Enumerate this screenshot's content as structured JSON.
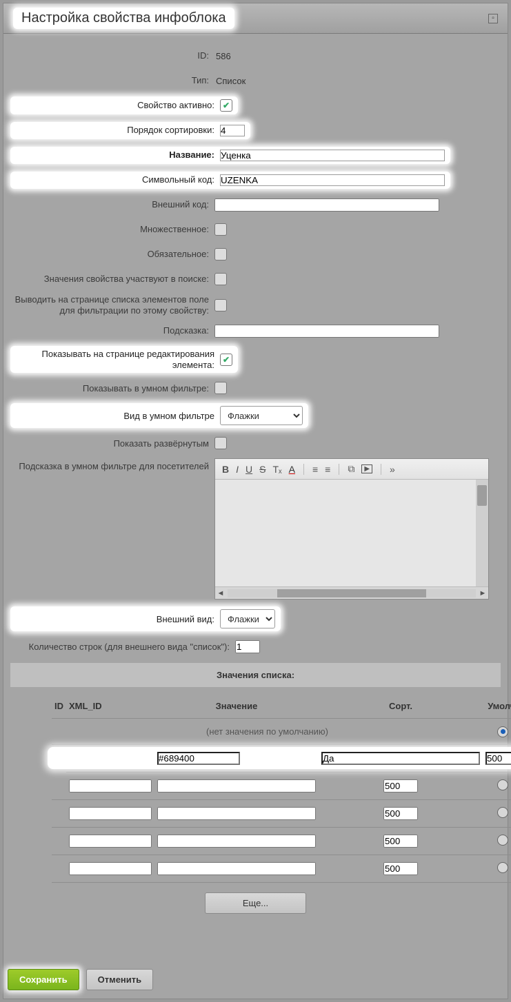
{
  "title": "Настройка свойства инфоблока",
  "form": {
    "id_label": "ID:",
    "id_value": "586",
    "type_label": "Тип:",
    "type_value": "Список",
    "active_label": "Свойство активно:",
    "active_checked": true,
    "sort_label": "Порядок сортировки:",
    "sort_value": "4",
    "name_label": "Название:",
    "name_value": "Уценка",
    "code_label": "Символьный код:",
    "code_value": "UZENKA",
    "ext_code_label": "Внешний код:",
    "ext_code_value": "",
    "multiple_label": "Множественное:",
    "required_label": "Обязательное:",
    "search_label": "Значения свойства участвуют в поиске:",
    "filter_list_label": "Выводить на странице списка элементов поле для фильтрации по этому свойству:",
    "hint_label": "Подсказка:",
    "hint_value": "",
    "show_edit_label": "Показывать на странице редактирования элемента:",
    "show_smart_label": "Показывать в умном фильтре:",
    "smart_view_label": "Вид в умном фильтре",
    "smart_view_value": "Флажки",
    "expanded_label": "Показать развёрнутым",
    "smart_hint_label": "Подсказка в умном фильтре для посетителей",
    "ext_view_label": "Внешний вид:",
    "ext_view_value": "Флажки",
    "rows_label": "Количество строк (для внешнего вида \"список\"):",
    "rows_value": "1"
  },
  "section_header": "Значения списка:",
  "table": {
    "headers": {
      "id": "ID",
      "xml": "XML_ID",
      "val": "Значение",
      "sort": "Сорт.",
      "def": "Умолч."
    },
    "default_row_text": "(нет значения по умолчанию)",
    "rows": [
      {
        "xml": "#689400",
        "val": "Да",
        "sort": "500",
        "def": false,
        "highlight": true
      },
      {
        "xml": "",
        "val": "",
        "sort": "500",
        "def": false,
        "highlight": false
      },
      {
        "xml": "",
        "val": "",
        "sort": "500",
        "def": false,
        "highlight": false
      },
      {
        "xml": "",
        "val": "",
        "sort": "500",
        "def": false,
        "highlight": false
      },
      {
        "xml": "",
        "val": "",
        "sort": "500",
        "def": false,
        "highlight": false
      }
    ],
    "more": "Еще..."
  },
  "toolbar_icons": {
    "bold": "B",
    "italic": "I",
    "underline": "U",
    "strike": "S",
    "clear": "Tₓ",
    "color": "A",
    "ol": "≡",
    "ul": "≡",
    "link": "⧉",
    "video": "▶",
    "more": "»"
  },
  "footer": {
    "save": "Сохранить",
    "cancel": "Отменить"
  }
}
